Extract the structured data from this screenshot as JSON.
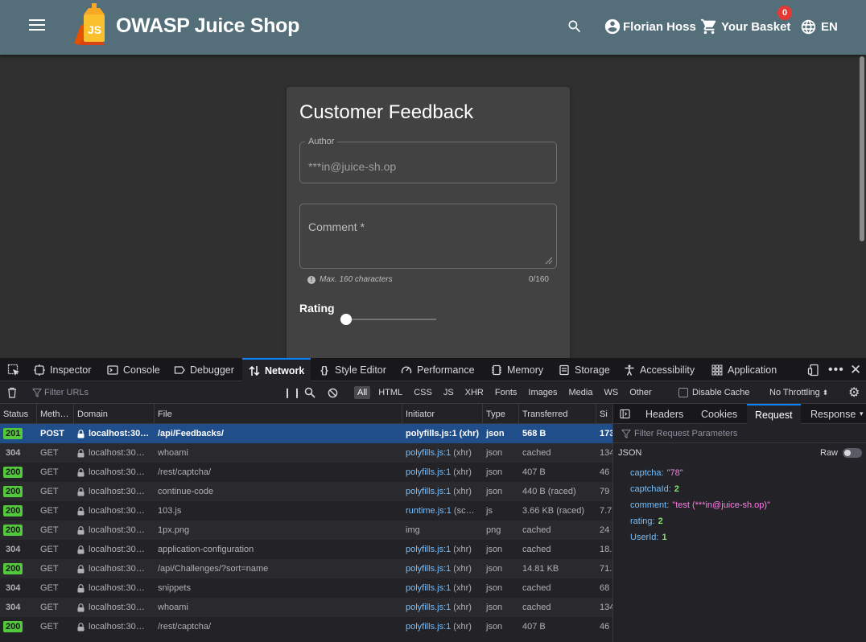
{
  "app": {
    "title": "OWASP Juice Shop",
    "user": "Florian Hoss",
    "basket_label": "Your Basket",
    "basket_count": "0",
    "language": "EN"
  },
  "feedback": {
    "title": "Customer Feedback",
    "author_label": "Author",
    "author_value": "***in@juice-sh.op",
    "comment_label": "Comment *",
    "hint": "Max. 160 characters",
    "counter": "0/160",
    "rating_label": "Rating"
  },
  "devtools": {
    "tabs": [
      {
        "label": "Inspector"
      },
      {
        "label": "Console"
      },
      {
        "label": "Debugger"
      },
      {
        "label": "Network"
      },
      {
        "label": "Style Editor"
      },
      {
        "label": "Performance"
      },
      {
        "label": "Memory"
      },
      {
        "label": "Storage"
      },
      {
        "label": "Accessibility"
      },
      {
        "label": "Application"
      }
    ],
    "filter_placeholder": "Filter URLs",
    "type_filters": [
      "All",
      "HTML",
      "CSS",
      "JS",
      "XHR",
      "Fonts",
      "Images",
      "Media",
      "WS",
      "Other"
    ],
    "disable_cache": "Disable Cache",
    "throttling": "No Throttling",
    "columns": [
      "Status",
      "Meth…",
      "Domain",
      "File",
      "Initiator",
      "Type",
      "Transferred",
      "Si"
    ],
    "rows": [
      {
        "status": "201",
        "method": "POST",
        "domain": "localhost:30…",
        "file": "/api/Feedbacks/",
        "initiator": "polyfills.js:1",
        "initiator_suffix": " (xhr)",
        "type": "json",
        "transferred": "568 B",
        "size": "173"
      },
      {
        "status": "304",
        "method": "GET",
        "domain": "localhost:30…",
        "file": "whoami",
        "initiator": "polyfills.js:1",
        "initiator_suffix": " (xhr)",
        "type": "json",
        "transferred": "cached",
        "size": "134"
      },
      {
        "status": "200",
        "method": "GET",
        "domain": "localhost:30…",
        "file": "/rest/captcha/",
        "initiator": "polyfills.js:1",
        "initiator_suffix": " (xhr)",
        "type": "json",
        "transferred": "407 B",
        "size": "46"
      },
      {
        "status": "200",
        "method": "GET",
        "domain": "localhost:30…",
        "file": "continue-code",
        "initiator": "polyfills.js:1",
        "initiator_suffix": " (xhr)",
        "type": "json",
        "transferred": "440 B (raced)",
        "size": "79"
      },
      {
        "status": "200",
        "method": "GET",
        "domain": "localhost:30…",
        "file": "103.js",
        "initiator": "runtime.js:1",
        "initiator_suffix": " (sc…",
        "type": "js",
        "transferred": "3.66 KB (raced)",
        "size": "7.7"
      },
      {
        "status": "200",
        "method": "GET",
        "domain": "localhost:30…",
        "file": "1px.png",
        "initiator": "",
        "initiator_suffix": "img",
        "type": "png",
        "transferred": "cached",
        "size": "24"
      },
      {
        "status": "304",
        "method": "GET",
        "domain": "localhost:30…",
        "file": "application-configuration",
        "initiator": "polyfills.js:1",
        "initiator_suffix": " (xhr)",
        "type": "json",
        "transferred": "cached",
        "size": "18."
      },
      {
        "status": "200",
        "method": "GET",
        "domain": "localhost:30…",
        "file": "/api/Challenges/?sort=name",
        "initiator": "polyfills.js:1",
        "initiator_suffix": " (xhr)",
        "type": "json",
        "transferred": "14.81 KB",
        "size": "71."
      },
      {
        "status": "304",
        "method": "GET",
        "domain": "localhost:30…",
        "file": "snippets",
        "initiator": "polyfills.js:1",
        "initiator_suffix": " (xhr)",
        "type": "json",
        "transferred": "cached",
        "size": "68"
      },
      {
        "status": "304",
        "method": "GET",
        "domain": "localhost:30…",
        "file": "whoami",
        "initiator": "polyfills.js:1",
        "initiator_suffix": " (xhr)",
        "type": "json",
        "transferred": "cached",
        "size": "134"
      },
      {
        "status": "200",
        "method": "GET",
        "domain": "localhost:30…",
        "file": "/rest/captcha/",
        "initiator": "polyfills.js:1",
        "initiator_suffix": " (xhr)",
        "type": "json",
        "transferred": "407 B",
        "size": "46"
      }
    ],
    "side_tabs": [
      "Headers",
      "Cookies",
      "Request",
      "Response"
    ],
    "side_filter_placeholder": "Filter Request Parameters",
    "json_label": "JSON",
    "raw_label": "Raw",
    "payload": [
      {
        "key": "captcha:",
        "value": "\"78\"",
        "kind": "string"
      },
      {
        "key": "captchaId:",
        "value": "2",
        "kind": "number"
      },
      {
        "key": "comment:",
        "value": "\"test (***in@juice-sh.op)\"",
        "kind": "string"
      },
      {
        "key": "rating:",
        "value": "2",
        "kind": "number"
      },
      {
        "key": "UserId:",
        "value": "1",
        "kind": "number"
      }
    ]
  }
}
